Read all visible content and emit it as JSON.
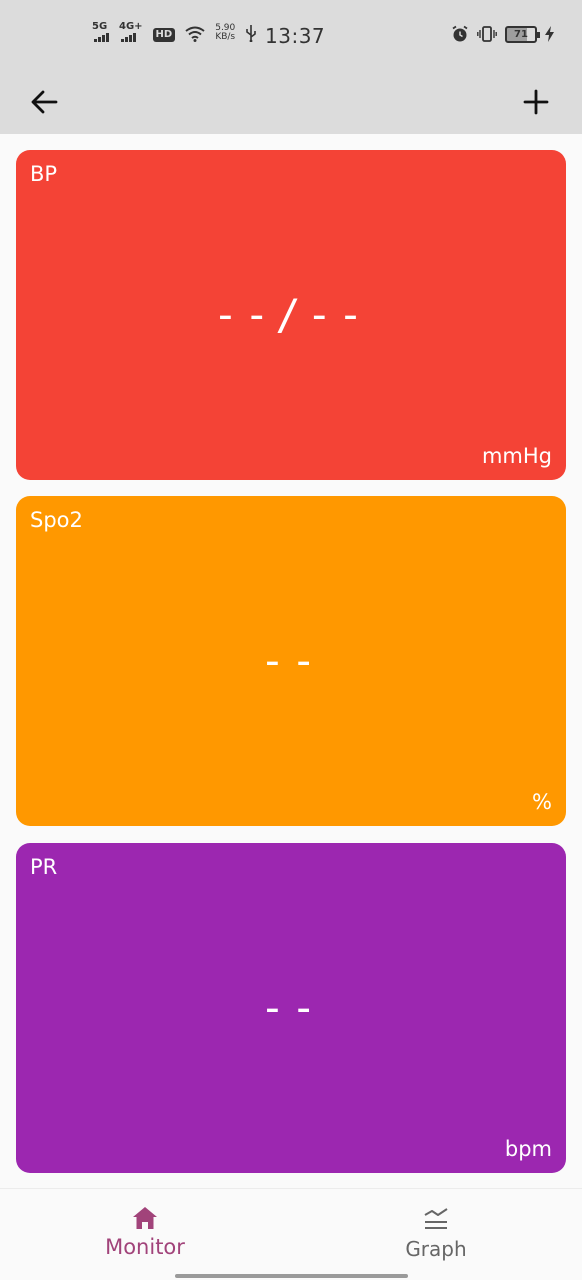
{
  "status_bar": {
    "sim1": "5G",
    "sim2": "4G+",
    "hd": "HD",
    "net_speed_value": "5.90",
    "net_speed_unit": "KB/s",
    "time": "13:37",
    "battery": "71",
    "battery_level_percent": 71
  },
  "app_bar": {
    "back_icon": "arrow-left-icon",
    "add_icon": "plus-icon"
  },
  "cards": {
    "bp": {
      "title": "BP",
      "value": "--/--",
      "unit": "mmHg",
      "color": "#f44336"
    },
    "spo2": {
      "title": "Spo2",
      "value": "--",
      "unit": "%",
      "color": "#ff9800"
    },
    "pr": {
      "title": "PR",
      "value": "--",
      "unit": "bpm",
      "color": "#9c27b0"
    }
  },
  "bottom_nav": {
    "items": [
      {
        "label": "Monitor",
        "icon": "home-icon",
        "active": true,
        "color": "#a1437a"
      },
      {
        "label": "Graph",
        "icon": "graph-icon",
        "active": false,
        "color": "#666666"
      }
    ]
  }
}
